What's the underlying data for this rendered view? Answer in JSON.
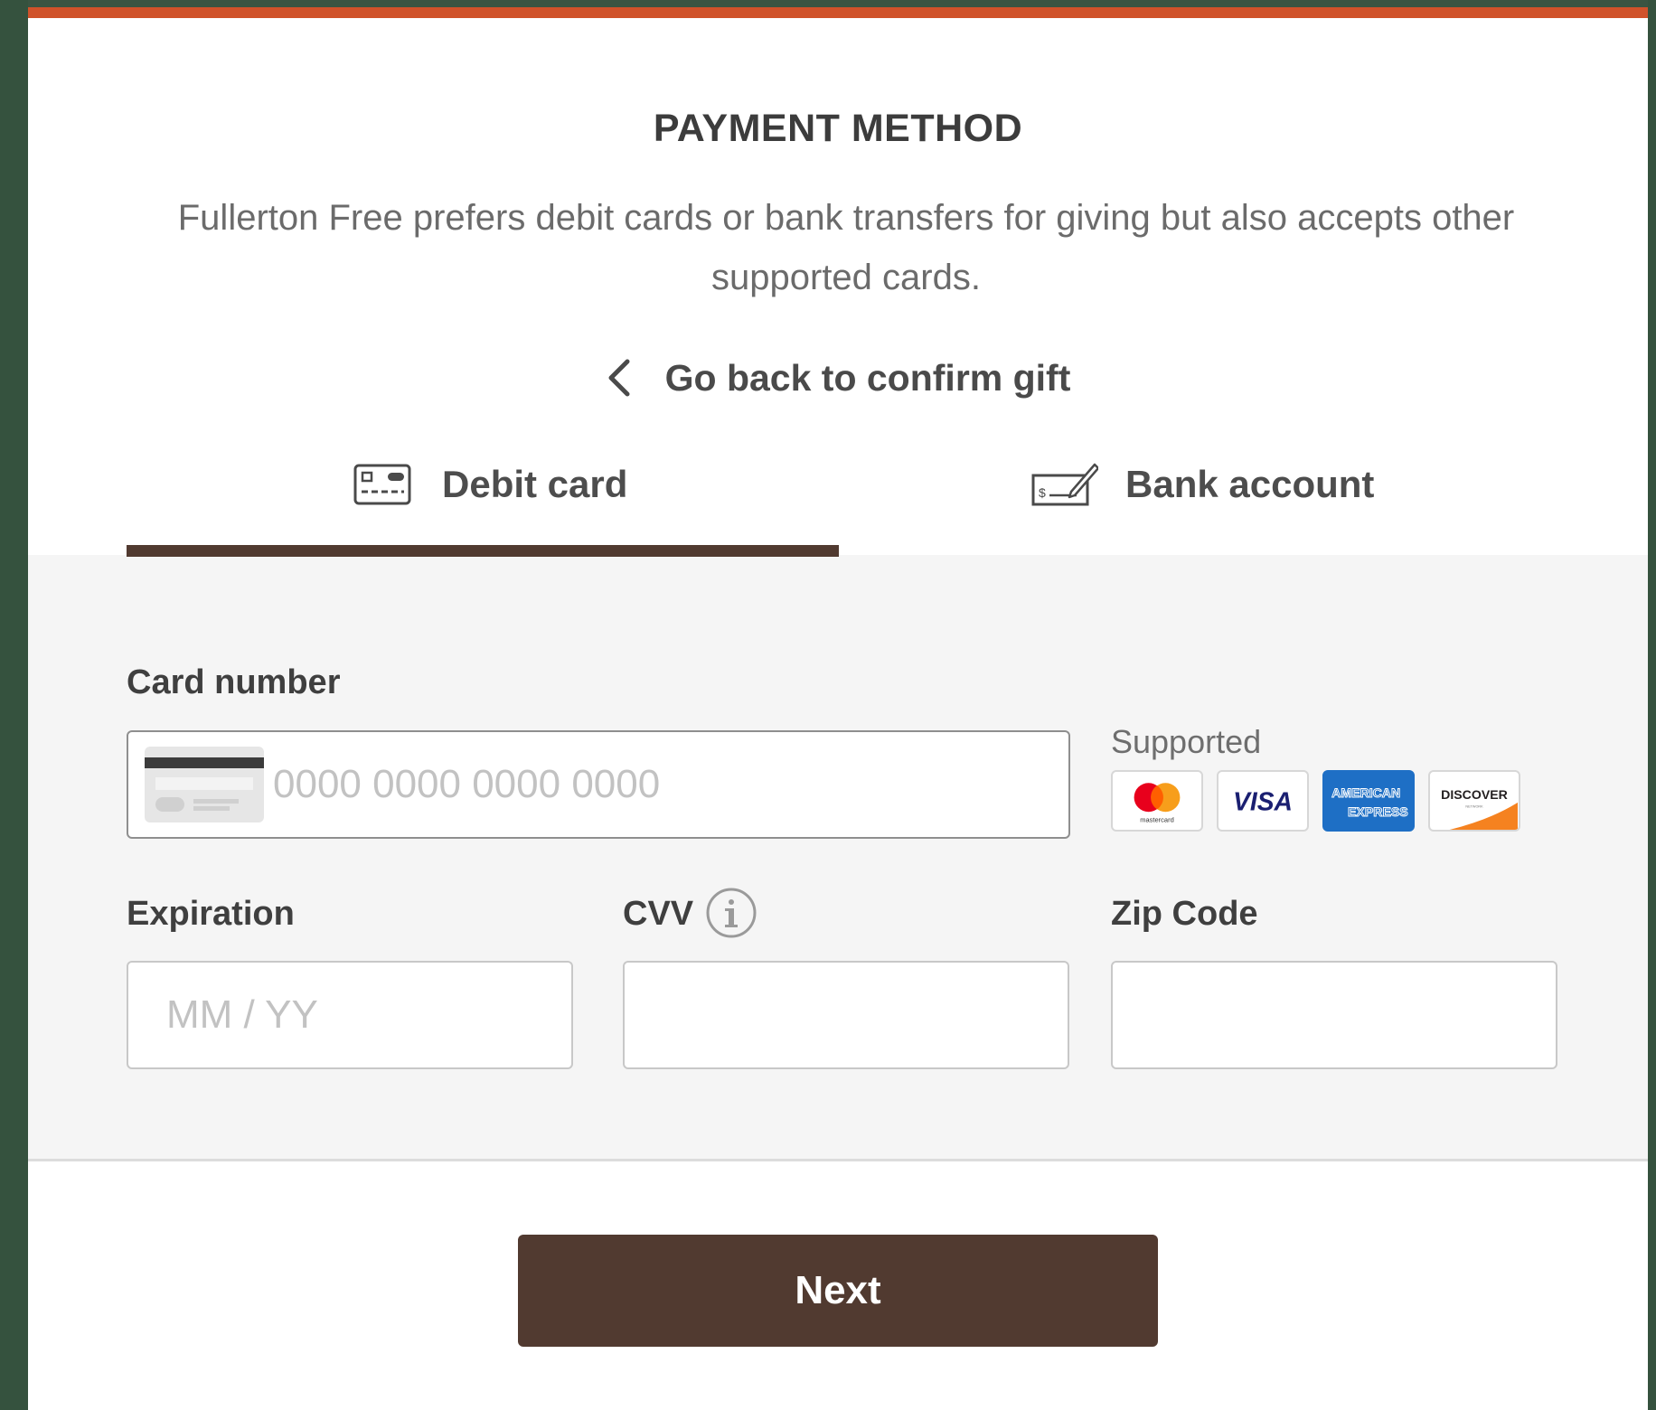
{
  "header": {
    "title": "PAYMENT METHOD",
    "description": "Fullerton Free prefers debit cards or bank transfers for giving but also accepts other supported cards.",
    "back_link": "Go back to confirm gift"
  },
  "tabs": [
    {
      "label": "Debit card",
      "icon": "debit-card-icon",
      "active": true
    },
    {
      "label": "Bank account",
      "icon": "check-icon",
      "active": false
    }
  ],
  "form": {
    "card_number": {
      "label": "Card number",
      "placeholder": "0000 0000 0000 0000",
      "value": ""
    },
    "supported": {
      "label": "Supported",
      "brands": [
        {
          "name": "mastercard",
          "text": "mastercard"
        },
        {
          "name": "VISA",
          "text": "VISA"
        },
        {
          "name": "American Express",
          "text": "AMERICAN",
          "text2": "EXPRESS"
        },
        {
          "name": "Discover",
          "text": "DISCOVER",
          "text2": "NETWORK"
        }
      ]
    },
    "expiration": {
      "label": "Expiration",
      "placeholder": "MM / YY",
      "value": ""
    },
    "cvv": {
      "label": "CVV",
      "value": "",
      "info_icon": "info-icon"
    },
    "zip": {
      "label": "Zip Code",
      "value": ""
    }
  },
  "actions": {
    "next_label": "Next"
  },
  "colors": {
    "accent_top": "#d0522a",
    "primary_brown": "#513a30",
    "page_bg": "#35523e",
    "form_bg": "#f5f5f5"
  }
}
